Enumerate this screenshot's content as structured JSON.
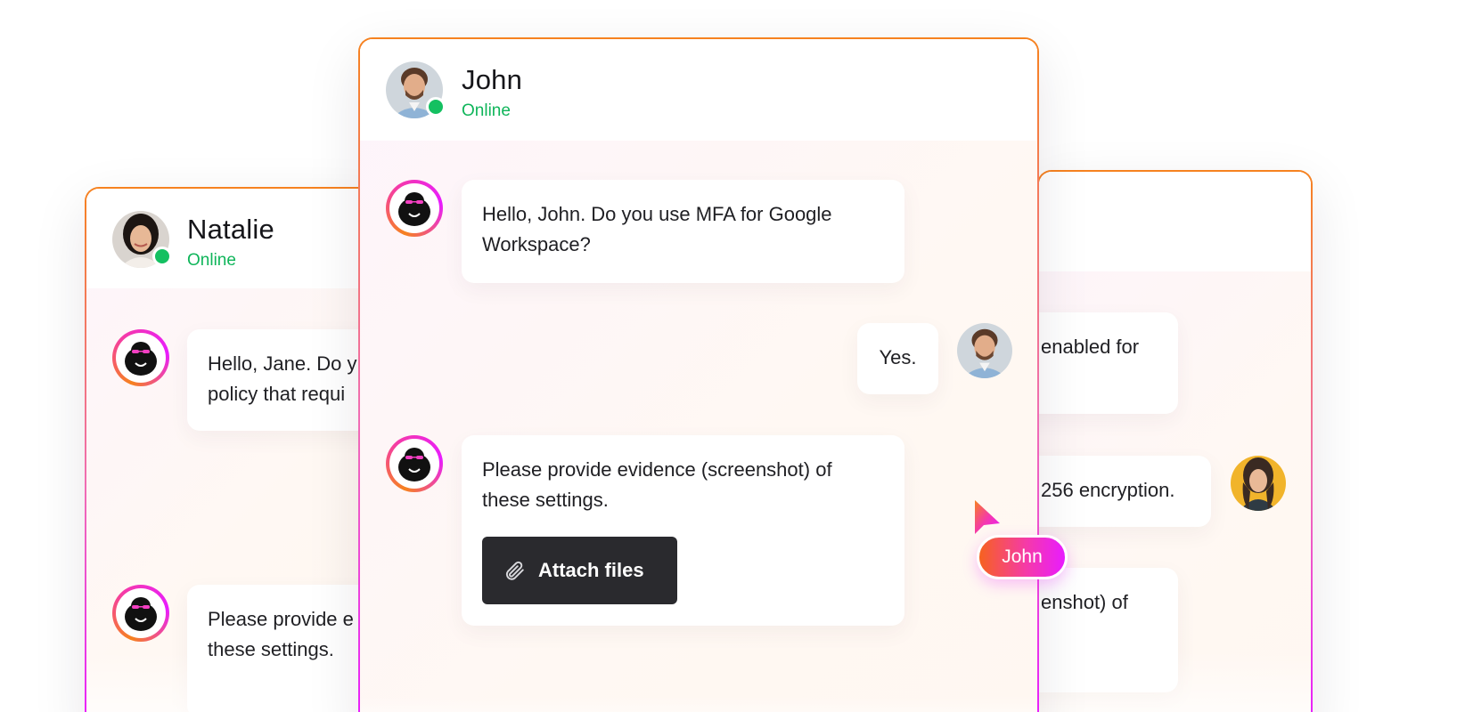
{
  "left_chat": {
    "contact_name": "Natalie",
    "status": "Online",
    "messages": [
      {
        "text_line1": "Hello, Jane. Do y",
        "text_line2": "policy that requi"
      },
      {
        "text_line1": "Please provide e",
        "text_line2": "these settings."
      }
    ]
  },
  "center_chat": {
    "contact_name": "John",
    "status": "Online",
    "messages": [
      {
        "from": "bot",
        "text_line1": "Hello, John. Do you use MFA for Google",
        "text_line2": "Workspace?"
      },
      {
        "from": "user",
        "text": "Yes."
      },
      {
        "from": "bot",
        "text_line1": "Please provide evidence (screenshot) of",
        "text_line2": "these settings."
      }
    ],
    "attach_label": "Attach files"
  },
  "right_chat": {
    "messages": [
      {
        "text": "enabled for"
      },
      {
        "text": "256 encryption."
      },
      {
        "text": "enshot) of"
      }
    ]
  },
  "cursor": {
    "label": "John"
  },
  "colors": {
    "accent_orange": "#f6821f",
    "accent_pink": "#f53aa8",
    "accent_magenta": "#e81cff",
    "online_green": "#14c061",
    "button_dark": "#2a2a2e"
  }
}
